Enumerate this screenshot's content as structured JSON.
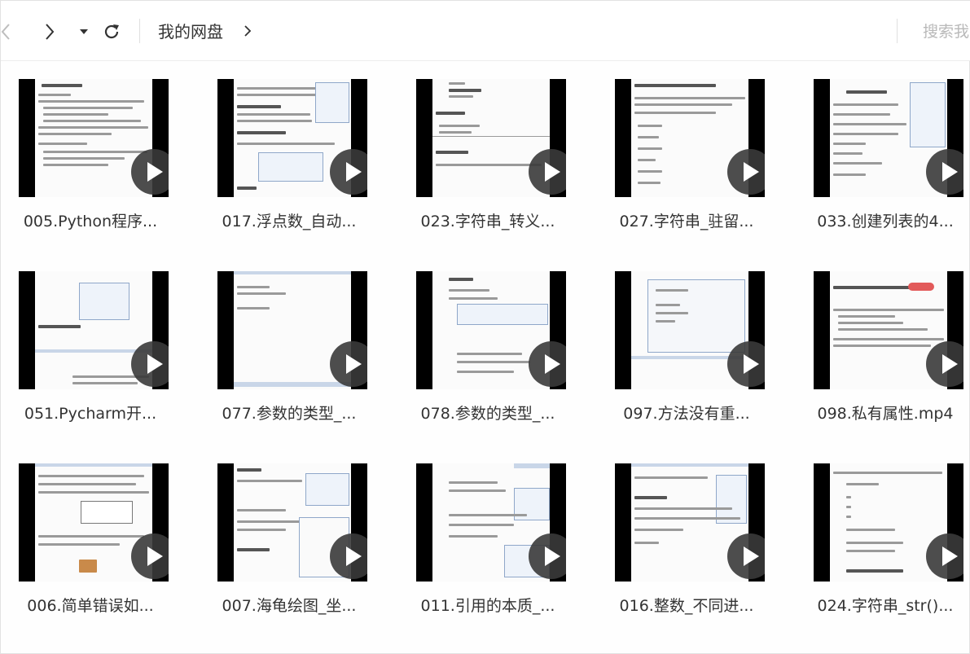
{
  "toolbar": {
    "breadcrumb": "我的网盘",
    "search_placeholder": "搜索我"
  },
  "icons": {
    "back": "chevron-left-icon",
    "forward": "chevron-right-icon",
    "history": "caret-down-icon",
    "refresh": "refresh-icon",
    "breadcrumb_next": "chevron-right-icon",
    "play": "play-icon"
  },
  "files": [
    {
      "name": "005.Python程序..."
    },
    {
      "name": "017.浮点数_自动..."
    },
    {
      "name": "023.字符串_转义..."
    },
    {
      "name": "027.字符串_驻留..."
    },
    {
      "name": "033.创建列表的4..."
    },
    {
      "name": "051.Pycharm开..."
    },
    {
      "name": "077.参数的类型_..."
    },
    {
      "name": "078.参数的类型_..."
    },
    {
      "name": "097.方法没有重..."
    },
    {
      "name": "098.私有属性.mp4"
    },
    {
      "name": "006.简单错误如..."
    },
    {
      "name": "007.海龟绘图_坐..."
    },
    {
      "name": "011.引用的本质_..."
    },
    {
      "name": "016.整数_不同进..."
    },
    {
      "name": "024.字符串_str()..."
    }
  ]
}
